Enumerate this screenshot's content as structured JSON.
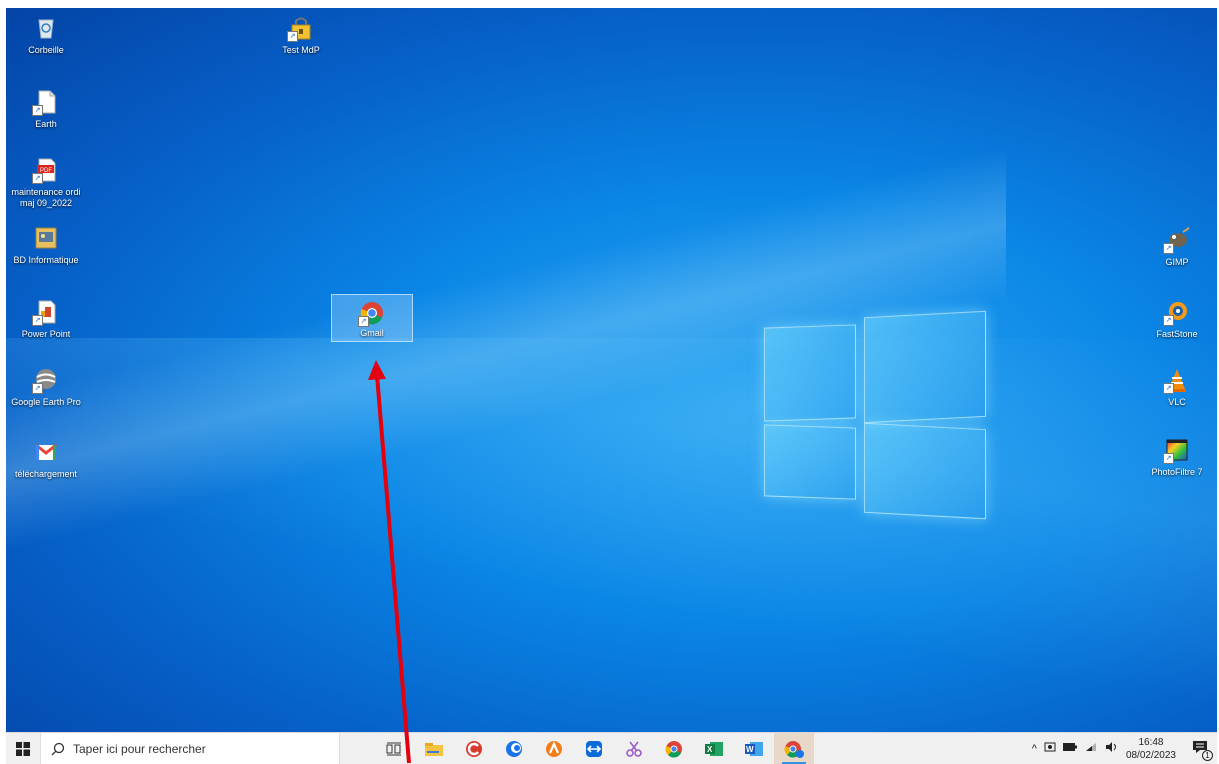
{
  "desktop": {
    "icons_left": [
      {
        "label": "Corbeille",
        "icon": "recycle-bin-icon"
      },
      {
        "label": "Earth",
        "icon": "file-shortcut-icon"
      },
      {
        "label": "maintenance ordi maj 09_2022",
        "icon": "pdf-icon"
      },
      {
        "label": "BD Informatique",
        "icon": "image-icon"
      },
      {
        "label": "Power Point",
        "icon": "powerpoint-icon"
      },
      {
        "label": "Google Earth Pro",
        "icon": "google-earth-icon"
      },
      {
        "label": "téléchargement",
        "icon": "gmail-icon"
      }
    ],
    "test_mdp": {
      "label": "Test MdP",
      "icon": "lock-folder-icon"
    },
    "gmail": {
      "label": "Gmail",
      "icon": "chrome-icon"
    },
    "icons_right": [
      {
        "label": "GIMP",
        "icon": "gimp-icon"
      },
      {
        "label": "FastStone",
        "icon": "faststone-icon"
      },
      {
        "label": "VLC",
        "icon": "vlc-icon"
      },
      {
        "label": "PhotoFiltre 7",
        "icon": "photofiltre-icon"
      }
    ]
  },
  "taskbar": {
    "search_placeholder": "Taper ici pour rechercher",
    "apps": [
      "task-view",
      "file-explorer",
      "ccleaner",
      "thunderbird-like",
      "avast",
      "teamviewer",
      "snipping",
      "chrome",
      "excel",
      "word",
      "chrome-profile"
    ],
    "clock_time": "16:48",
    "clock_date": "08/02/2023",
    "notification_count": "1"
  },
  "colors": {
    "arrow": "#e3000f",
    "accent": "#0a78d7"
  }
}
